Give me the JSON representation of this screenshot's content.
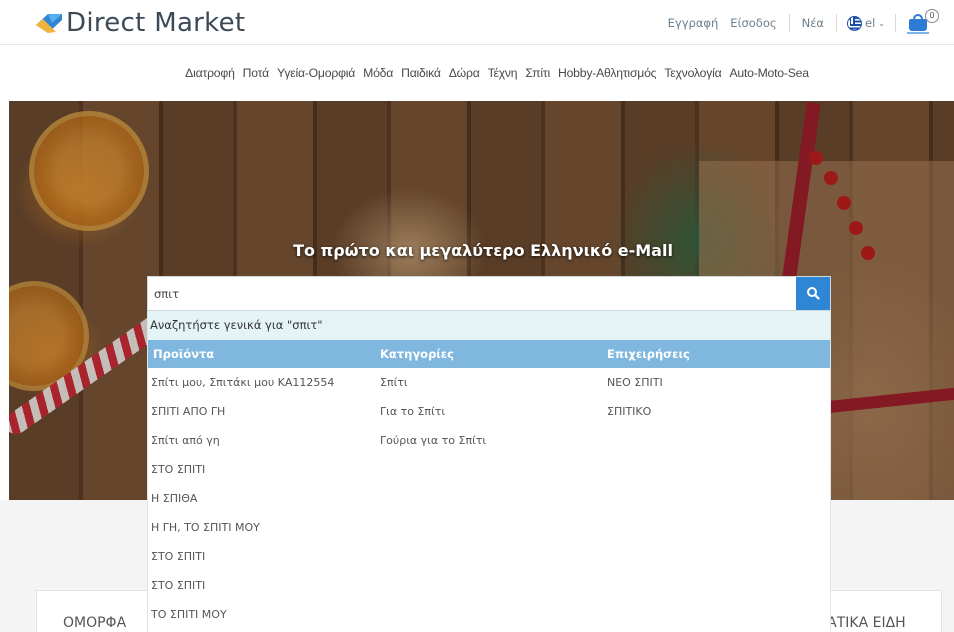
{
  "header": {
    "logo_text": "Direct Market",
    "links": {
      "register": "Εγγραφή",
      "login": "Είσοδος",
      "news": "Νέα"
    },
    "language": "el",
    "cart_count": "0"
  },
  "nav": {
    "items": [
      "Διατροφή",
      "Ποτά",
      "Υγεία-Ομορφιά",
      "Μόδα",
      "Παιδικά",
      "Δώρα",
      "Τέχνη",
      "Σπίτι",
      "Hobby-Αθλητισμός",
      "Τεχνολογία",
      "Auto-Moto-Sea"
    ]
  },
  "hero": {
    "title": "Το πρώτο και μεγαλύτερο Ελληνικό e-Mall"
  },
  "search": {
    "value": "σπιτ"
  },
  "suggestions": {
    "general": "Αναζητήστε γενικά για \"σπιτ\"",
    "columns": {
      "products": "Προϊόντα",
      "categories": "Κατηγορίες",
      "businesses": "Επιχειρήσεις"
    },
    "products": [
      "Σπίτι μου, Σπιτάκι μου ΚΑ112554",
      "ΣΠΙΤΙ ΑΠΟ ΓΗ",
      "Σπίτι από γη",
      "ΣΤΟ ΣΠΙΤΙ",
      "Η ΣΠΙΘΑ",
      "Η ΓΗ, ΤΟ ΣΠΙΤΙ ΜΟΥ",
      "ΣΤΟ ΣΠΙΤΙ",
      "ΣΤΟ ΣΠΙΤΙ",
      "ΤΟ ΣΠΙΤΙ ΜΟΥ"
    ],
    "categories": [
      "Σπίτι",
      "Για το Σπίτι",
      "Γούρια για το Σπίτι"
    ],
    "businesses": [
      "ΝΕΟ ΣΠΙΤΙ",
      "ΣΠΙΤΙΚΟ"
    ]
  },
  "cards": {
    "left": "ΟΜΟΡΦΑ",
    "right": "ΙΑΤΙΚΑ ΕΙΔΗ"
  },
  "colors": {
    "accent": "#2e86d4",
    "column_header": "#7fb7df",
    "general_row": "#e4f3f6"
  }
}
